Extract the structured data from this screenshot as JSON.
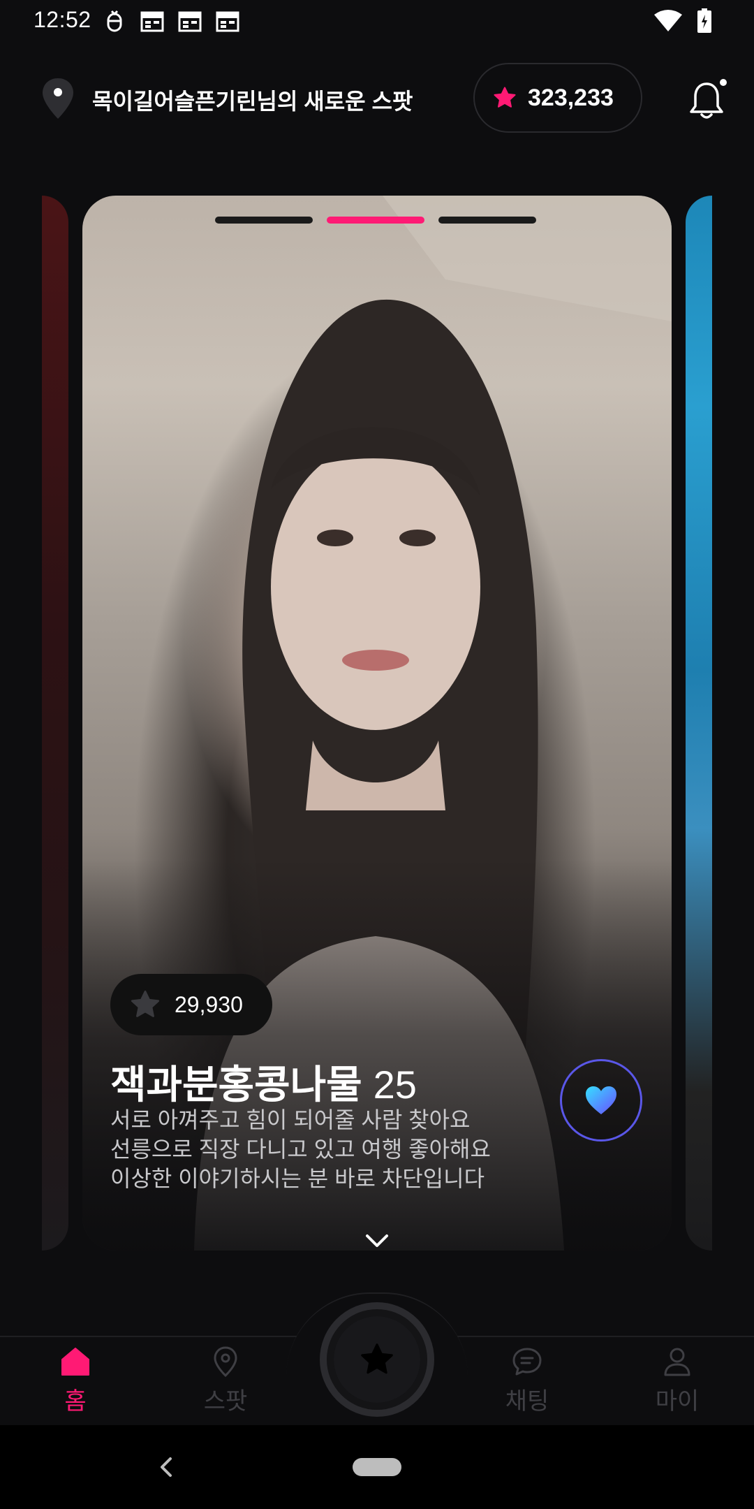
{
  "status_bar": {
    "time": "12:52"
  },
  "header": {
    "spot_title": "목이길어슬픈기린님의 새로운 스팟",
    "points": "323,233"
  },
  "profile": {
    "likes": "29,930",
    "name": "잭과분홍콩나물",
    "age": "25",
    "bio": [
      "서로 아껴주고 힘이 되어줄 사람 찾아요",
      "선릉으로 직장 다니고 있고 여행 좋아해요",
      "이상한 이야기하시는 분 바로 차단입니다"
    ],
    "photo_progress": {
      "total": 3,
      "active_index": 1
    }
  },
  "bottom_nav": {
    "items": [
      {
        "label": "홈",
        "active": true
      },
      {
        "label": "스팟",
        "active": false
      },
      {
        "label": "채팅",
        "active": false
      },
      {
        "label": "마이",
        "active": false
      }
    ]
  },
  "colors": {
    "accent": "#ff1a74",
    "background": "#0d0d0f",
    "like_ring": "#5a57e8"
  }
}
